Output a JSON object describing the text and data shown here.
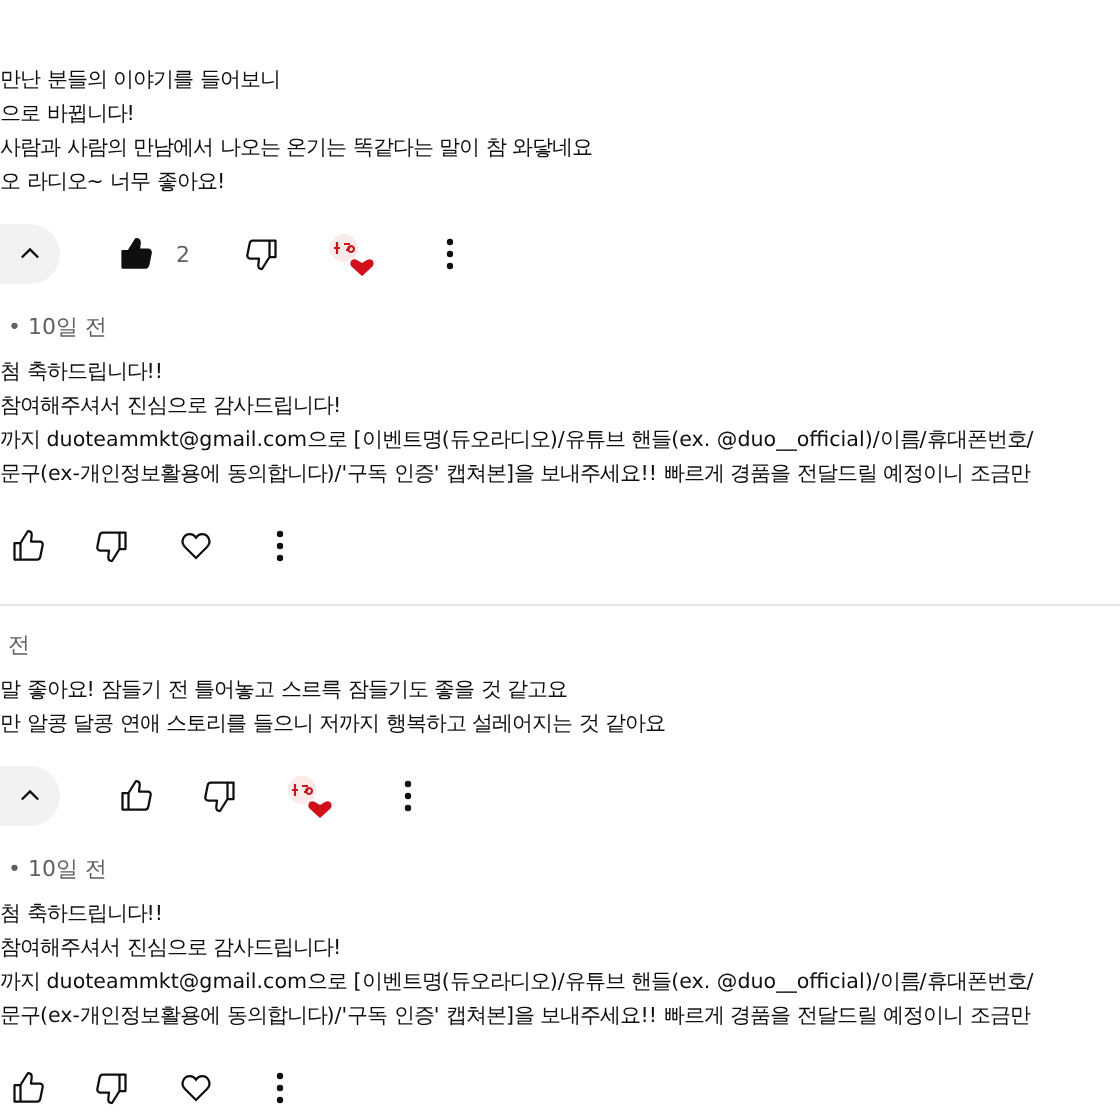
{
  "threads": [
    {
      "comment": {
        "body": [
          "만난 분들의 이야기를  들어보니",
          "으로 바뀝니다!",
          "사람과 사람의 만남에서 나오는 온기는 똑같다는 말이 참 와닿네요",
          "오 라디오~ 너무 좋아요!"
        ],
        "actions": {
          "collapse": true,
          "liked": true,
          "like_count": "2",
          "creator_heart": true
        }
      },
      "reply": {
        "time": "• 10일 전",
        "body": [
          "첨 축하드립니다!!",
          "참여해주셔서 진심으로 감사드립니다!",
          "까지 duoteammkt@gmail.com으로 [이벤트명(듀오라디오)/유튜브 핸들(ex. @duo__official)/이름/휴대폰번호/",
          "문구(ex-개인정보활용에 동의합니다)/'구독 인증' 캡쳐본]을 보내주세요!! 빠르게 경품을 전달드릴 예정이니 조금만"
        ],
        "actions": {
          "liked": false,
          "hearted": false
        }
      }
    },
    {
      "comment": {
        "time": "전",
        "body": [
          "말 좋아요! 잠들기 전 틀어놓고 스르륵 잠들기도 좋을 것 같고요",
          "만 알콩 달콩 연애 스토리를 들으니 저까지 행복하고 설레어지는 것 같아요"
        ],
        "actions": {
          "collapse": true,
          "liked": false,
          "creator_heart": true
        }
      },
      "reply": {
        "time": "• 10일 전",
        "body": [
          "첨 축하드립니다!!",
          "참여해주셔서 진심으로 감사드립니다!",
          "까지 duoteammkt@gmail.com으로 [이벤트명(듀오라디오)/유튜브 핸들(ex. @duo__official)/이름/휴대폰번호/",
          "문구(ex-개인정보활용에 동의합니다)/'구독 인증' 캡쳐본]을 보내주세요!! 빠르게 경품을 전달드릴 예정이니 조금만"
        ],
        "actions": {
          "liked": false,
          "hearted": false
        }
      }
    }
  ]
}
